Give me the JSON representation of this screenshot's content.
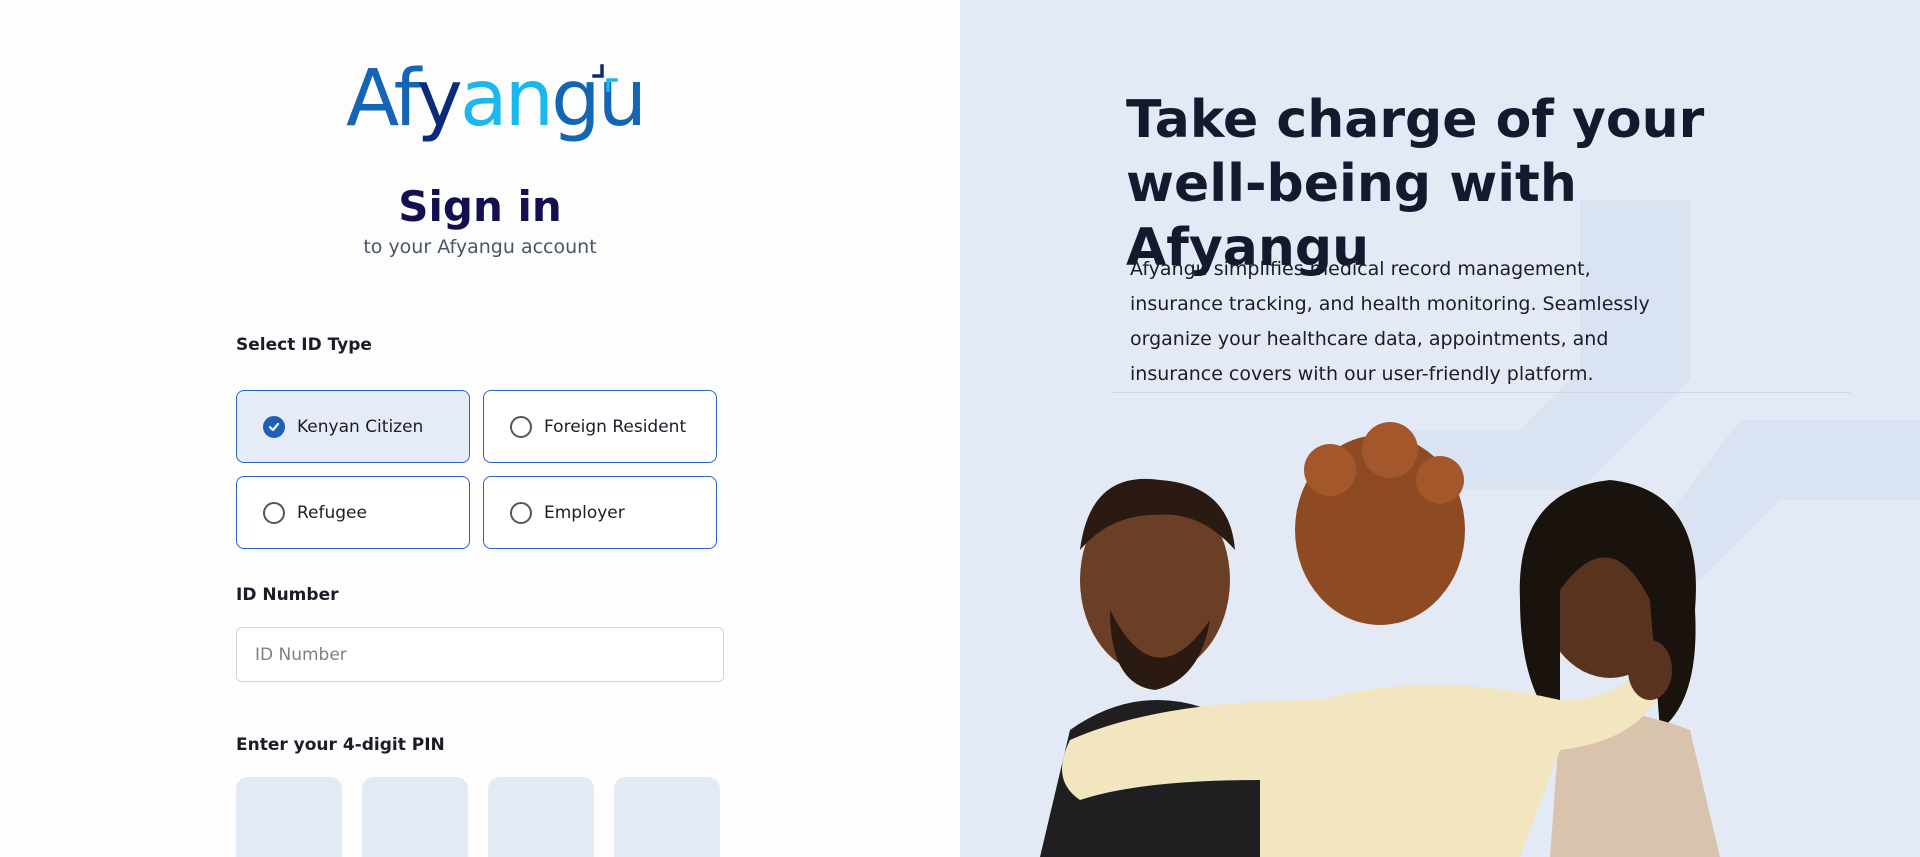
{
  "brand": {
    "logo_parts": [
      "Af",
      "y",
      "an",
      "gu"
    ],
    "colors": {
      "primary": "#1565b5",
      "dark": "#0b2a78",
      "light": "#1ab8ec",
      "title": "#140f4f",
      "panel_bg": "#e4eaf5",
      "pin_bg": "#e3e9f5"
    }
  },
  "signin": {
    "title": "Sign in",
    "subtitle": "to your Afyangu account",
    "id_type_label": "Select ID Type",
    "id_types": [
      {
        "label": "Kenyan Citizen",
        "selected": true
      },
      {
        "label": "Foreign Resident",
        "selected": false
      },
      {
        "label": "Refugee",
        "selected": false
      },
      {
        "label": "Employer",
        "selected": false
      }
    ],
    "id_number_label": "ID Number",
    "id_number_placeholder": "ID Number",
    "id_number_value": "",
    "pin_label": "Enter your 4-digit PIN",
    "pin_digits": [
      "",
      "",
      "",
      ""
    ]
  },
  "hero": {
    "headline_line1": "Take charge of your",
    "headline_line2": "well-being with Afyangu",
    "description": "Afyangu simplifies medical record management, insurance tracking, and health monitoring. Seamlessly organize your healthcare data, appointments, and insurance covers with our user-friendly platform.",
    "image_icon": "family-photo"
  }
}
